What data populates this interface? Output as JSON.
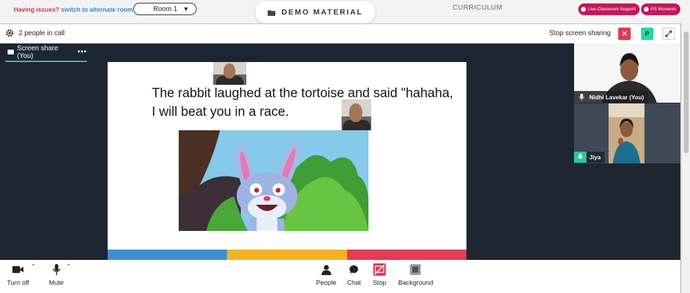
{
  "topbar": {
    "issues_text": "Having issues?",
    "alternate_link": "switch to alternate room",
    "room_select": "Room 1",
    "room_arrow": "▼",
    "demo_material": "DEMO MATERIAL",
    "curriculum": "CURRICULUM",
    "live_support": "Live Classroom Support",
    "ps_moments": "PS Moments"
  },
  "call_header": {
    "people_count": "2 people in call",
    "stop_screen_sharing": "Stop screen sharing",
    "close_symbol": "✕",
    "presenter_badge": "P"
  },
  "screen_share": {
    "tab_label": "Screen share (You)",
    "more_symbol": "•••",
    "slide_text": "The rabbit laughed at the tortoise and said \"hahaha, I will beat you in a race.",
    "bar_colors": [
      "#3f8fcb",
      "#f4b322",
      "#e23c56"
    ]
  },
  "participants": [
    {
      "name": "Nidhi Lavekar (You)"
    },
    {
      "name": "Jiya"
    }
  ],
  "controls": {
    "turn_off": "Turn off",
    "mute": "Mute",
    "people": "People",
    "chat": "Chat",
    "stop": "Stop",
    "background": "Background",
    "caret": "⌄"
  },
  "colors": {
    "accent_teal": "#2ec4a0",
    "danger_red": "#e53950",
    "support_pink": "#c2185b",
    "stage_dark": "#1d2630"
  }
}
